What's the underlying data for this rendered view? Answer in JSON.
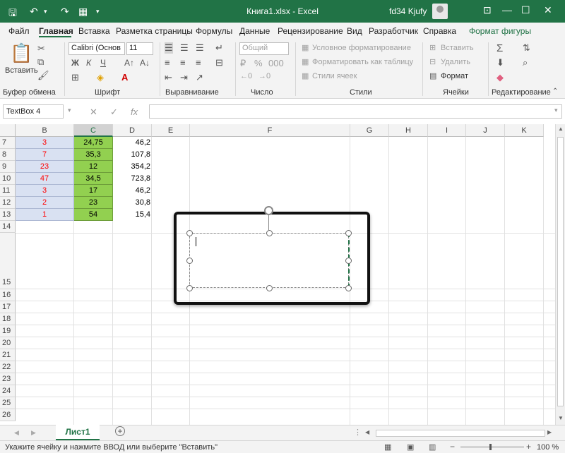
{
  "titlebar": {
    "title": "Книга1.xlsx  -  Excel",
    "user": "fd34 Kjufy"
  },
  "tabs": [
    "Файл",
    "Главная",
    "Вставка",
    "Разметка страницы",
    "Формулы",
    "Данные",
    "Рецензирование",
    "Вид",
    "Разработчик",
    "Справка",
    "Формат фигуры"
  ],
  "ribbon": {
    "clipboard": {
      "paste": "Вставить",
      "label": "Буфер обмена"
    },
    "font": {
      "name": "Calibri (Основ",
      "size": "11",
      "label": "Шрифт"
    },
    "align": {
      "label": "Выравнивание"
    },
    "number": {
      "format": "Общий",
      "label": "Число"
    },
    "styles": {
      "cond": "Условное форматирование",
      "table": "Форматировать как таблицу",
      "cell": "Стили ячеек",
      "label": "Стили"
    },
    "cells": {
      "insert": "Вставить",
      "delete": "Удалить",
      "format": "Формат",
      "label": "Ячейки"
    },
    "editing": {
      "label": "Редактирование"
    }
  },
  "formulabar": {
    "namebox": "TextBox 4",
    "fx": "fx",
    "value": ""
  },
  "sheet": {
    "columns": [
      "B",
      "C",
      "D",
      "E",
      "F",
      "G",
      "H",
      "I",
      "J",
      "K"
    ],
    "rows": [
      "7",
      "8",
      "9",
      "10",
      "11",
      "12",
      "13",
      "14",
      "15",
      "16",
      "17",
      "18",
      "19",
      "20",
      "21",
      "22",
      "23",
      "24",
      "25",
      "26"
    ],
    "data": [
      [
        "3",
        "24,75",
        "46,2"
      ],
      [
        "7",
        "35,3",
        "107,8"
      ],
      [
        "23",
        "12",
        "354,2"
      ],
      [
        "47",
        "34,5",
        "723,8"
      ],
      [
        "3",
        "17",
        "46,2"
      ],
      [
        "2",
        "23",
        "30,8"
      ],
      [
        "1",
        "54",
        "15,4"
      ]
    ]
  },
  "sheettabs": {
    "active": "Лист1",
    "add": "+"
  },
  "statusbar": {
    "message": "Укажите ячейку и нажмите ВВОД или выберите \"Вставить\"",
    "zoom": "100 %"
  },
  "colors": {
    "accent": "#217346",
    "col_b": "#d9e1f2",
    "col_c": "#92d050",
    "red_text": "#ff0000"
  }
}
